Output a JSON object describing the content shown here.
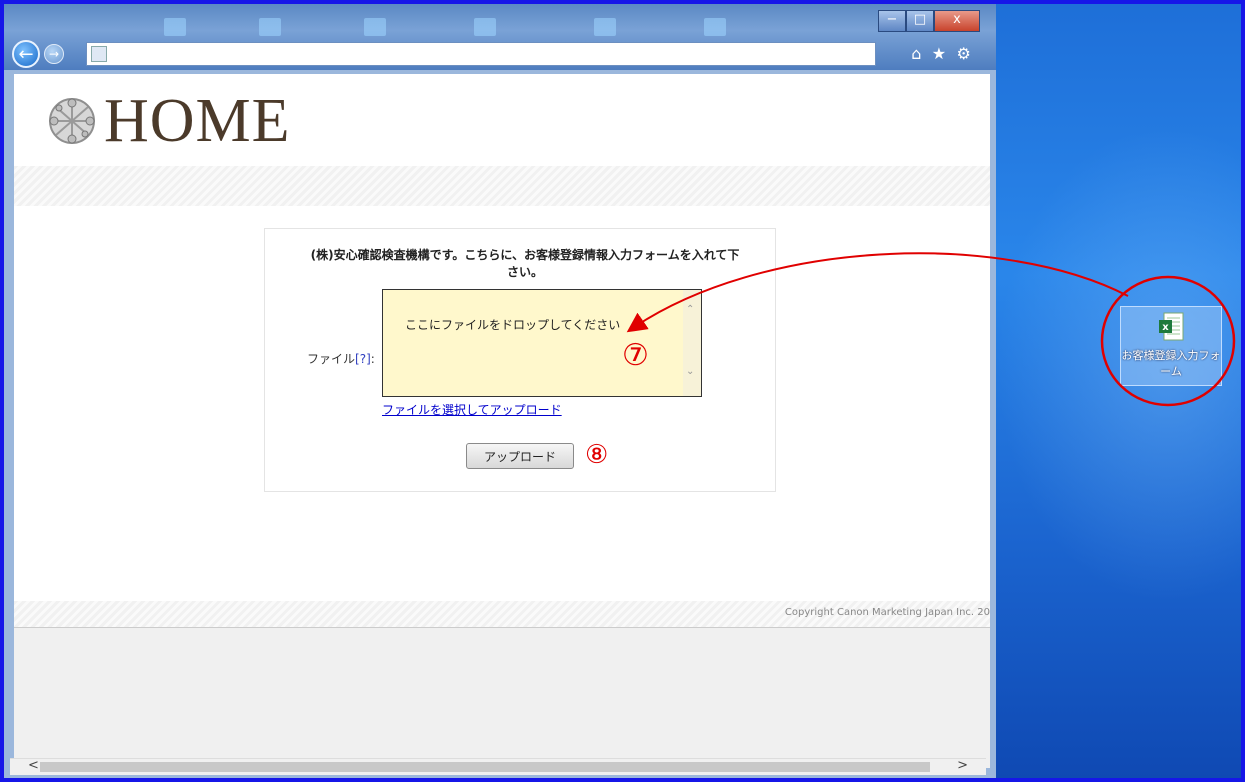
{
  "header": {
    "logo_text": "HOME"
  },
  "form": {
    "instruction": "(株)安心確認検査機構です。こちらに、お客様登録情報入力フォームを入れて下さい。",
    "file_label": "ファイル",
    "file_help": "[?]",
    "file_colon": ":",
    "drop_placeholder": "ここにファイルをドロップしてください",
    "select_link": "ファイルを選択してアップロード",
    "upload_button": "アップロード"
  },
  "annotations": {
    "step7": "⑦",
    "step8": "⑧"
  },
  "footer": {
    "copyright": "Copyright Canon Marketing Japan Inc. 20"
  },
  "desktop": {
    "icon_label": "お客様登録入力フォーム"
  },
  "colors": {
    "annotation_red": "#e00000",
    "drop_bg": "#fff8cc",
    "desktop_blue": "#1e6fd8"
  }
}
